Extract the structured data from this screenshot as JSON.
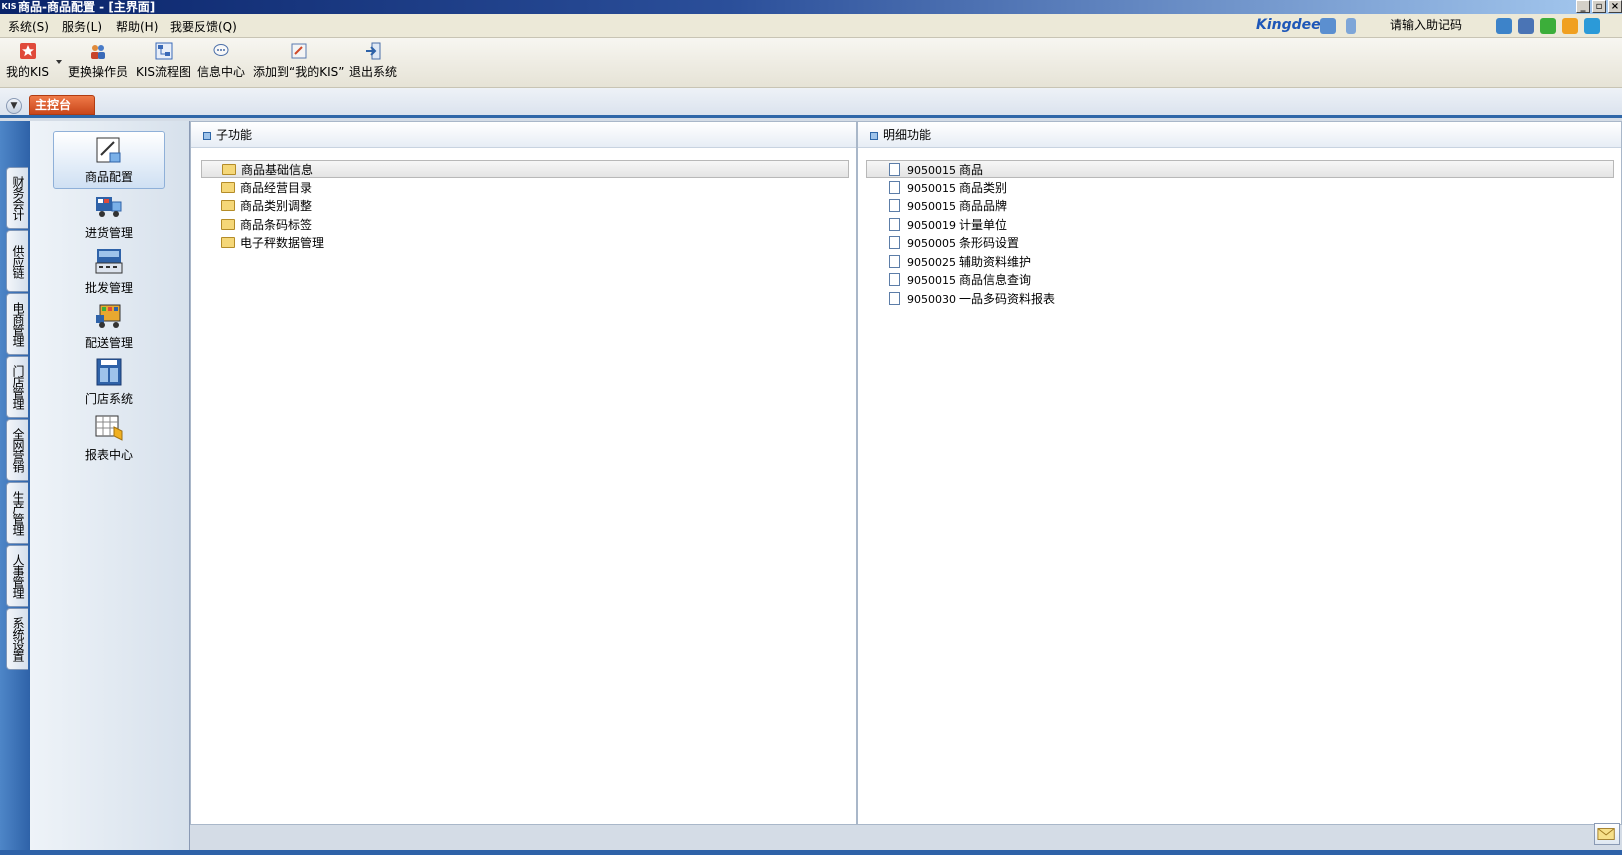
{
  "window": {
    "icon_text": "KIS",
    "title": "商品-商品配置 - [主界面]"
  },
  "menu": [
    {
      "label": "系统(S)"
    },
    {
      "label": "服务(L)"
    },
    {
      "label": "帮助(H)"
    },
    {
      "label": "我要反馈(Q)"
    }
  ],
  "header": {
    "brand": "Kingdee",
    "help_code_label": "请输入助记码"
  },
  "toolbar": [
    {
      "label": "我的KIS",
      "icon": "star-icon"
    },
    {
      "label": "更换操作员",
      "icon": "users-icon"
    },
    {
      "label": "KIS流程图",
      "icon": "flowchart-icon"
    },
    {
      "label": "信息中心",
      "icon": "message-icon"
    },
    {
      "label": "添加到“我的KIS”",
      "icon": "add-favorite-icon"
    },
    {
      "label": "退出系统",
      "icon": "exit-icon"
    }
  ],
  "tabs": {
    "main": "主控台"
  },
  "side_tabs": [
    "财务会计",
    "供应链",
    "电商管理",
    "门店管理",
    "全网营销",
    "生产管理",
    "人事管理",
    "系统设置"
  ],
  "modules": [
    {
      "label": "商品配置",
      "icon": "product-config-icon",
      "active": true
    },
    {
      "label": "进货管理",
      "icon": "truck-icon"
    },
    {
      "label": "批发管理",
      "icon": "cash-register-icon"
    },
    {
      "label": "配送管理",
      "icon": "delivery-icon"
    },
    {
      "label": "门店系统",
      "icon": "shop-icon"
    },
    {
      "label": "报表中心",
      "icon": "report-icon"
    }
  ],
  "subfunctions": {
    "title": "子功能",
    "items": [
      "商品基础信息",
      "商品经营目录",
      "商品类别调整",
      "商品条码标签",
      "电子秤数据管理"
    ]
  },
  "details": {
    "title": "明细功能",
    "items": [
      {
        "code": "9050015",
        "name": "商品"
      },
      {
        "code": "9050015",
        "name": "商品类别"
      },
      {
        "code": "9050015",
        "name": "商品品牌"
      },
      {
        "code": "9050019",
        "name": "计量单位"
      },
      {
        "code": "9050005",
        "name": "条形码设置"
      },
      {
        "code": "9050025",
        "name": "辅助资料维护"
      },
      {
        "code": "9050015",
        "name": "商品信息查询"
      },
      {
        "code": "9050030",
        "name": "一品多码资料报表"
      }
    ]
  },
  "colors": {
    "title_bar": "#0a246a",
    "tab_active": "#d85a28",
    "nav_blue": "#2e62a8"
  }
}
